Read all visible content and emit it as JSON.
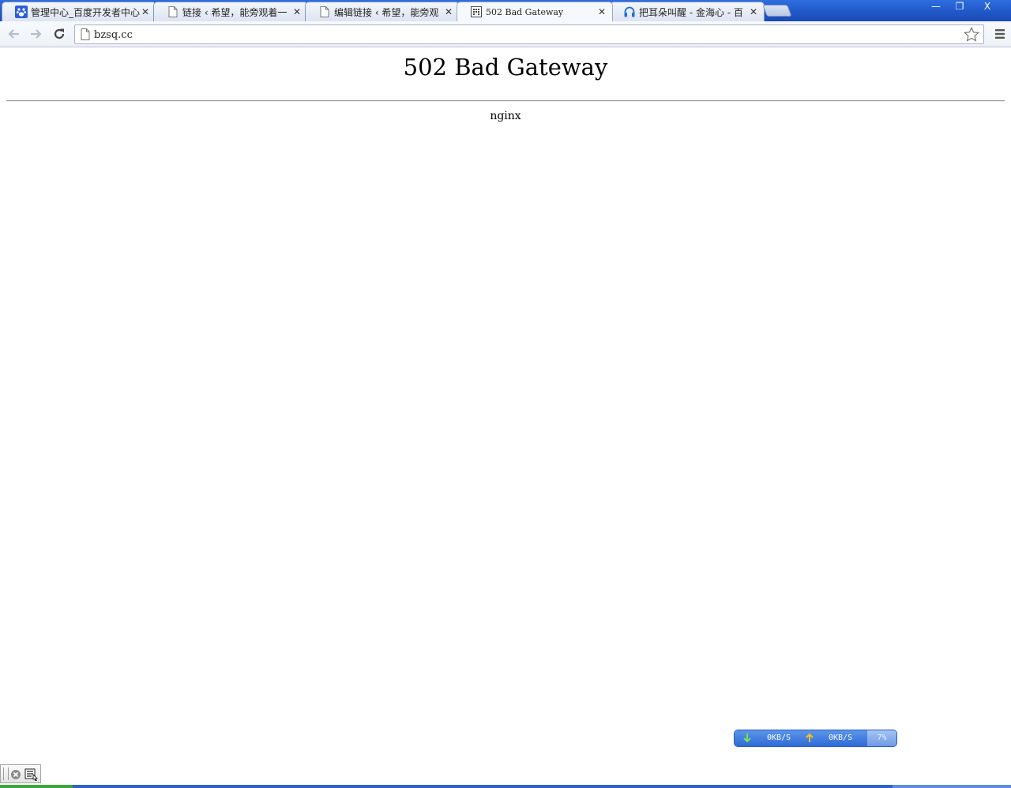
{
  "browser": {
    "tabs": [
      {
        "title": "管理中心_百度开发者中心",
        "icon": "baidu-paw-icon",
        "active": false
      },
      {
        "title": "链接 ‹ 希望，能旁观着一",
        "icon": "page-icon",
        "active": false
      },
      {
        "title": "编辑链接 ‹ 希望，能旁观",
        "icon": "page-icon",
        "active": false
      },
      {
        "title": "502 Bad Gateway",
        "icon": "building-icon",
        "active": true
      },
      {
        "title": "把耳朵叫醒 - 金海心 - 百",
        "icon": "headphones-icon",
        "active": false
      }
    ],
    "address": {
      "url": "bzsq.cc"
    },
    "window_buttons": {
      "minimize": "—",
      "restore": "❐",
      "close": "X"
    }
  },
  "page": {
    "heading": "502 Bad Gateway",
    "server": "nginx"
  },
  "speed_widget": {
    "download": "0KB/S",
    "upload": "0KB/S",
    "percent": "7%"
  },
  "colors": {
    "tabstrip": "#1f55c6",
    "download_arrow": "#7fe14a",
    "upload_arrow": "#f3c21a"
  }
}
